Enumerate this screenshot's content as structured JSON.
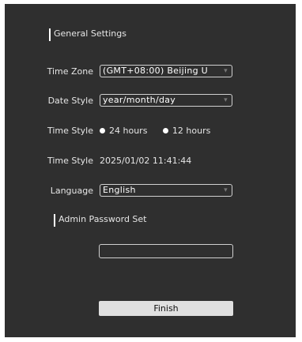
{
  "general_settings": {
    "title": "General Settings"
  },
  "time_zone": {
    "label": "Time Zone",
    "value": "(GMT+08:00) Beijing U"
  },
  "date_style": {
    "label": "Date Style",
    "value": "year/month/day"
  },
  "time_style": {
    "label": "Time Style",
    "options": [
      "24 hours",
      "12 hours"
    ],
    "selected": "24 hours"
  },
  "time_display": {
    "label": "Time Style",
    "value": "2025/01/02 11:41:44"
  },
  "language": {
    "label": "Language",
    "value": "English"
  },
  "admin_password": {
    "title": "Admin Password Set",
    "value": ""
  },
  "finish": {
    "label": "Finish"
  },
  "icons": {
    "dropdown": "chevron-down-icon",
    "radio": "radio-button-icon"
  },
  "colors": {
    "panel_bg": "#2f2f2f",
    "text": "#e6e6e6",
    "button_bg": "#e0e0e0"
  }
}
